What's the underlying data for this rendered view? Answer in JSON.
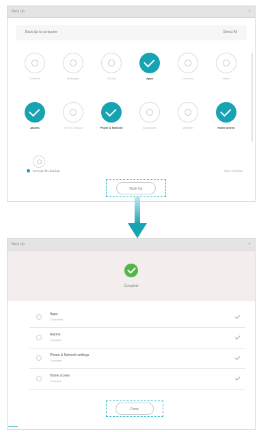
{
  "window1": {
    "title": "Back Up",
    "subhead": "Back Up to computer",
    "select_all": "Select All",
    "categories": [
      {
        "label": "Contacts",
        "sub": "",
        "selected": false,
        "icon": "contacts-icon"
      },
      {
        "label": "Messages",
        "sub": "",
        "selected": false,
        "icon": "messages-icon"
      },
      {
        "label": "Call log",
        "sub": "",
        "selected": false,
        "icon": "call-log-icon"
      },
      {
        "label": "Apps",
        "sub": "",
        "selected": true,
        "icon": "apps-icon"
      },
      {
        "label": "Calendar",
        "sub": "",
        "selected": false,
        "icon": "calendar-icon"
      },
      {
        "label": "Notes",
        "sub": "",
        "selected": false,
        "icon": "notes-icon"
      },
      {
        "label": "Alarms",
        "sub": "",
        "selected": true,
        "icon": "alarms-icon"
      },
      {
        "label": "Wi-Fi & Hotspot",
        "sub": "",
        "selected": false,
        "icon": "wifi-icon"
      },
      {
        "label": "Phone & Network",
        "sub": "",
        "selected": true,
        "icon": "phone-icon"
      },
      {
        "label": "Bookmarks",
        "sub": "",
        "selected": false,
        "icon": "bookmarks-icon"
      },
      {
        "label": "Weather",
        "sub": "",
        "selected": false,
        "icon": "weather-icon"
      },
      {
        "label": "Home screen",
        "sub": "",
        "selected": true,
        "icon": "home-screen-icon"
      }
    ],
    "extra_item_label": "",
    "option_label": "Encrypt this backup",
    "more_label": "More settings",
    "button_label": "Back Up"
  },
  "window2": {
    "title": "Back Up",
    "status_label": "Complete",
    "items": [
      {
        "title": "Apps",
        "status": "Completed"
      },
      {
        "title": "Alarms",
        "status": "Complete"
      },
      {
        "title": "Phone & Network settings",
        "status": "Complete"
      },
      {
        "title": "Home screen",
        "status": "Complete"
      }
    ],
    "button_label": "Done"
  },
  "colors": {
    "accent": "#17a3b2",
    "success": "#53b649",
    "status_band": "#f3eded"
  }
}
